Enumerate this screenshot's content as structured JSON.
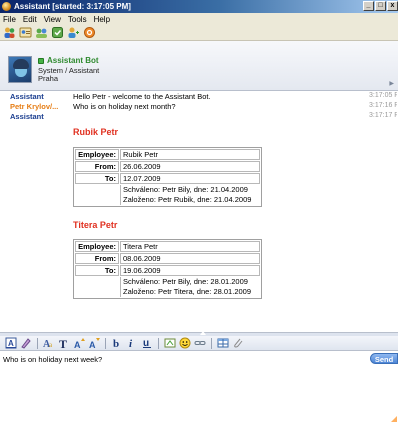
{
  "window": {
    "title": "Assistant [started: 3:17:05 PM]",
    "buttons": [
      "_",
      "□",
      "x"
    ]
  },
  "menu": [
    "File",
    "Edit",
    "View",
    "Tools",
    "Help"
  ],
  "toolbar_icons": [
    "people-icon",
    "contact-card-icon",
    "group-icon",
    "history-icon",
    "add-user-icon",
    "email-icon"
  ],
  "contact": {
    "name": "Assistant Bot",
    "line1": "System / Assistant",
    "line2": "Praha",
    "status_color": "#46b246"
  },
  "messages": [
    {
      "sender": "Assistant",
      "sender_color": "#1a3d8f",
      "text": "Hello Petr - welcome to the Assistant Bot.",
      "time": "3:17:05 PM"
    },
    {
      "sender": "Petr Krylov/...",
      "sender_color": "#e67e16",
      "text": "Who is on holiday next month?",
      "time": "3:17:16 PM"
    },
    {
      "sender": "Assistant",
      "sender_color": "#1a3d8f",
      "text": "",
      "time": "3:17:17 PM"
    }
  ],
  "employees": [
    {
      "title": "Rubik Petr",
      "employee_label": "Employee:",
      "employee": "Rubik Petr",
      "from_label": "From:",
      "from": "26.06.2009",
      "to_label": "To:",
      "to": "12.07.2009",
      "approved": "Schváleno: Petr Bily, dne: 21.04.2009",
      "created": "Založeno: Petr Rubik, dne: 21.04.2009"
    },
    {
      "title": "Titera Petr",
      "employee_label": "Employee:",
      "employee": "Titera Petr",
      "from_label": "From:",
      "from": "08.06.2009",
      "to_label": "To:",
      "to": "19.06.2009",
      "approved": "Schváleno: Petr Bily, dne: 28.01.2009",
      "created": "Založeno: Petr Titera, dne: 28.01.2009"
    }
  ],
  "format_icons": [
    "text-color-icon",
    "highlight-icon",
    "font-icon",
    "font-size-icon",
    "grow-font-icon",
    "shrink-font-icon",
    "bold-icon",
    "italic-icon",
    "underline-icon",
    "stationery-icon",
    "emoticon-icon",
    "link-icon",
    "table-icon",
    "attach-icon"
  ],
  "input": {
    "value": "Who is on holiday next week?",
    "send_label": "Send"
  },
  "colors": {
    "accent": "#4d86d6",
    "employee_title": "#e03020"
  }
}
